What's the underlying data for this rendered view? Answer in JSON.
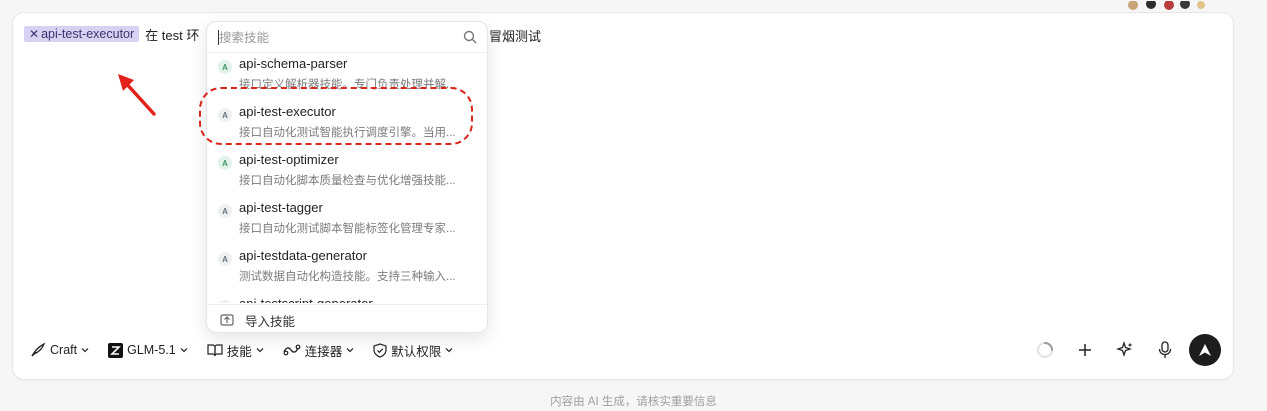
{
  "prompt": {
    "chip_close": "✕",
    "chip_label": "api-test-executor",
    "text_before": "在 test 环",
    "text_after": "冒烟测试"
  },
  "skill_picker": {
    "search_placeholder": "搜索技能",
    "items": [
      {
        "name": "api-schema-parser",
        "desc": "接口定义解析器技能。专门负责处理并解...",
        "badge": "A"
      },
      {
        "name": "api-test-executor",
        "desc": "接口自动化测试智能执行调度引擎。当用...",
        "badge": "A"
      },
      {
        "name": "api-test-optimizer",
        "desc": "接口自动化脚本质量检查与优化增强技能...",
        "badge": "A"
      },
      {
        "name": "api-test-tagger",
        "desc": "接口自动化测试脚本智能标签化管理专家...",
        "badge": "A"
      },
      {
        "name": "api-testdata-generator",
        "desc": "测试数据自动化构造技能。支持三种输入...",
        "badge": "A"
      },
      {
        "name": "api-testscript-generator",
        "desc": "",
        "badge": "A"
      }
    ],
    "import_label": "导入技能"
  },
  "toolbar": {
    "craft_label": "Craft",
    "model_label": "GLM-5.1",
    "skills_label": "技能",
    "connectors_label": "连接器",
    "permissions_label": "默认权限"
  },
  "footer_note": "内容由 AI 生成，请核实重要信息",
  "colors": {
    "chip_bg": "#d7d2f2",
    "highlight_red": "#d9261c",
    "send_button": "#1d1d1d"
  }
}
